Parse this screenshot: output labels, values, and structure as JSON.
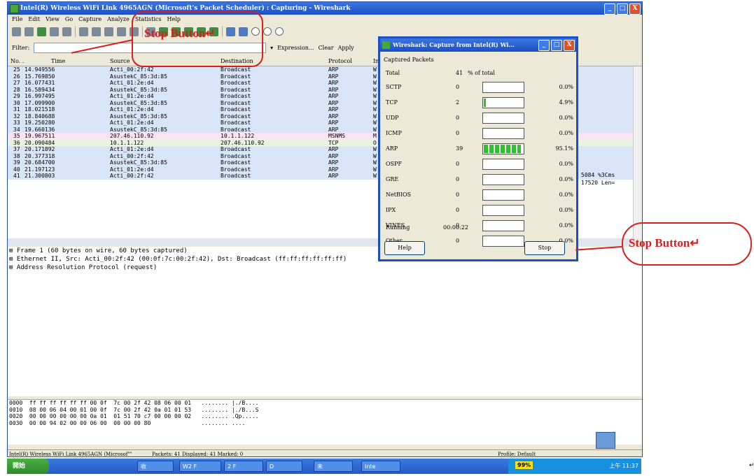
{
  "window": {
    "title": "Intel(R) Wireless WiFi Link 4965AGN (Microsoft's Packet Scheduler) : Capturing - Wireshark",
    "buttons": [
      "_",
      "□",
      "X"
    ]
  },
  "menu": [
    "File",
    "Edit",
    "View",
    "Go",
    "Capture",
    "Analyze",
    "Statistics",
    "Help"
  ],
  "filter": {
    "label": "Filter:",
    "expression": "Expression...",
    "clear": "Clear",
    "apply": "Apply"
  },
  "columns": [
    "No. .",
    "Time",
    "Source",
    "Destination",
    "Protocol",
    "Info"
  ],
  "packets": [
    {
      "no": "25",
      "time": "14.949556",
      "src": "Acti_00:2f:42",
      "dst": "Broadcast",
      "proto": "ARP",
      "info": "W",
      "cls": "arp"
    },
    {
      "no": "26",
      "time": "15.769850",
      "src": "AsustekC_85:3d:85",
      "dst": "Broadcast",
      "proto": "ARP",
      "info": "W",
      "cls": "arp"
    },
    {
      "no": "27",
      "time": "16.077431",
      "src": "Acti_01:2e:d4",
      "dst": "Broadcast",
      "proto": "ARP",
      "info": "W",
      "cls": "arp"
    },
    {
      "no": "28",
      "time": "16.589434",
      "src": "AsustekC_85:3d:85",
      "dst": "Broadcast",
      "proto": "ARP",
      "info": "W",
      "cls": "arp"
    },
    {
      "no": "29",
      "time": "16.997495",
      "src": "Acti_01:2e:d4",
      "dst": "Broadcast",
      "proto": "ARP",
      "info": "W",
      "cls": "arp"
    },
    {
      "no": "30",
      "time": "17.099900",
      "src": "AsustekC_85:3d:85",
      "dst": "Broadcast",
      "proto": "ARP",
      "info": "W",
      "cls": "arp"
    },
    {
      "no": "31",
      "time": "18.021518",
      "src": "Acti_01:2e:d4",
      "dst": "Broadcast",
      "proto": "ARP",
      "info": "W",
      "cls": "arp"
    },
    {
      "no": "32",
      "time": "18.840688",
      "src": "AsustekC_85:3d:85",
      "dst": "Broadcast",
      "proto": "ARP",
      "info": "W",
      "cls": "arp"
    },
    {
      "no": "33",
      "time": "19.250280",
      "src": "Acti_01:2e:d4",
      "dst": "Broadcast",
      "proto": "ARP",
      "info": "W",
      "cls": "arp"
    },
    {
      "no": "34",
      "time": "19.660136",
      "src": "AsustekC_85:3d:85",
      "dst": "Broadcast",
      "proto": "ARP",
      "info": "W",
      "cls": "arp"
    },
    {
      "no": "35",
      "time": "19.967511",
      "src": "207.46.110.92",
      "dst": "10.1.1.122",
      "proto": "MSNMS",
      "info": "M",
      "cls": "msnms"
    },
    {
      "no": "36",
      "time": "20.090484",
      "src": "10.1.1.122",
      "dst": "207.46.110.92",
      "proto": "TCP",
      "info": "O",
      "cls": "tcp"
    },
    {
      "no": "37",
      "time": "20.171892",
      "src": "Acti_01:2e:d4",
      "dst": "Broadcast",
      "proto": "ARP",
      "info": "W",
      "cls": "arp"
    },
    {
      "no": "38",
      "time": "20.377318",
      "src": "Acti_00:2f:42",
      "dst": "Broadcast",
      "proto": "ARP",
      "info": "W",
      "cls": "arp"
    },
    {
      "no": "39",
      "time": "20.684700",
      "src": "AsustekC_85:3d:85",
      "dst": "Broadcast",
      "proto": "ARP",
      "info": "W",
      "cls": "arp"
    },
    {
      "no": "40",
      "time": "21.197123",
      "src": "Acti_01:2e:d4",
      "dst": "Broadcast",
      "proto": "ARP",
      "info": "W",
      "cls": "arp"
    },
    {
      "no": "41",
      "time": "21.300803",
      "src": "Acti_00:2f:42",
      "dst": "Broadcast",
      "proto": "ARP",
      "info": "W",
      "cls": "arp"
    }
  ],
  "info_overflow": {
    "row35": "5084 %3Cms",
    "row36": "17520 Len="
  },
  "details": [
    "⊞ Frame 1 (60 bytes on wire, 60 bytes captured)",
    "⊞ Ethernet II, Src: Acti_00:2f:42 (00:0f:7c:00:2f:42), Dst: Broadcast (ff:ff:ff:ff:ff:ff)",
    "⊞ Address Resolution Protocol (request)"
  ],
  "hex": [
    "0000  ff ff ff ff ff ff 00 0f  7c 00 2f 42 08 06 00 01   ........ |./B....",
    "0010  08 00 06 04 00 01 00 0f  7c 00 2f 42 0a 01 01 53   ........ |./B...S",
    "0020  00 00 00 00 00 00 0a 01  01 51 70 c7 00 00 00 02   ........ .Qp.....",
    "0030  00 00 94 02 00 00 06 00  00 00 00 80               ........ ...."
  ],
  "status": {
    "left": "Intel(R) Wireless WiFi Link 4965AGN (Microsof\"\"",
    "packets": "Packets: 41 Displayed: 41 Marked: 0",
    "profile": "Profile: Default"
  },
  "dialog": {
    "title": "Wireshark: Capture from Intel(R) Wi...",
    "group": "Captured Packets",
    "total_label": "Total",
    "total_count": "41",
    "pct_header": "% of total",
    "rows": [
      {
        "name": "SCTP",
        "count": "0",
        "pct": "0.0%",
        "frac": 0
      },
      {
        "name": "TCP",
        "count": "2",
        "pct": "4.9%",
        "frac": 0.049
      },
      {
        "name": "UDP",
        "count": "0",
        "pct": "0.0%",
        "frac": 0
      },
      {
        "name": "ICMP",
        "count": "0",
        "pct": "0.0%",
        "frac": 0
      },
      {
        "name": "ARP",
        "count": "39",
        "pct": "95.1%",
        "frac": 0.951
      },
      {
        "name": "OSPF",
        "count": "0",
        "pct": "0.0%",
        "frac": 0
      },
      {
        "name": "GRE",
        "count": "0",
        "pct": "0.0%",
        "frac": 0
      },
      {
        "name": "NetBIOS",
        "count": "0",
        "pct": "0.0%",
        "frac": 0
      },
      {
        "name": "IPX",
        "count": "0",
        "pct": "0.0%",
        "frac": 0
      },
      {
        "name": "VINES",
        "count": "0",
        "pct": "0.0%",
        "frac": 0
      },
      {
        "name": "Other",
        "count": "0",
        "pct": "0.0%",
        "frac": 0
      }
    ],
    "running_label": "Running",
    "running_time": "00:00:22",
    "help": "Help",
    "stop": "Stop"
  },
  "annotations": {
    "top": "Stop Button↵",
    "right": "Stop Button↵",
    "trailing": "↵"
  },
  "taskbar": {
    "start": "開始",
    "items": [
      "收",
      "W2 F",
      "2 F",
      "D",
      "未",
      "Inte"
    ],
    "battery": "99%",
    "clock": "上午 11:37"
  },
  "colors": {
    "callout": "#d81e1e",
    "arp_row": "#d8e4f8",
    "msnms_row": "#fbe3f4",
    "progress": "#2bc32b"
  }
}
